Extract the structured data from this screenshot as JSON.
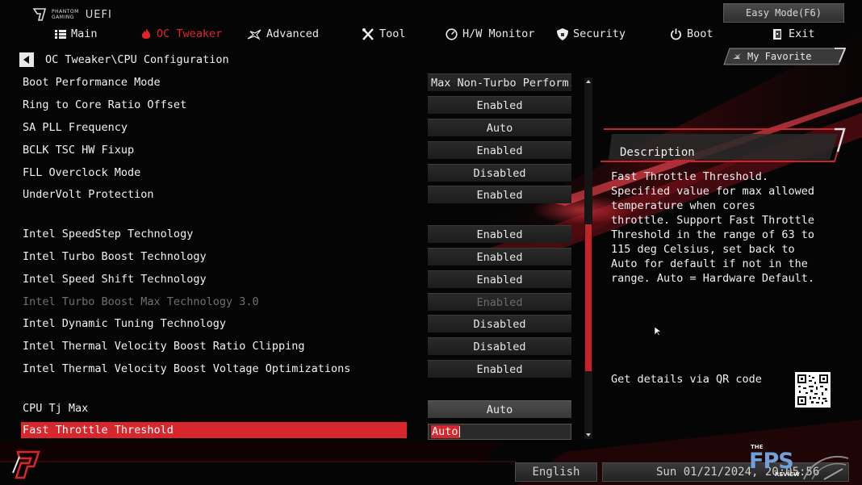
{
  "brand": {
    "line1": "PHANTOM",
    "line2": "GAMING",
    "uefi": "UEFI"
  },
  "easy_mode_label": "Easy Mode(F6)",
  "nav": [
    {
      "label": "Main",
      "icon": "list-icon",
      "active": false
    },
    {
      "label": "OC Tweaker",
      "icon": "flame-icon",
      "active": true
    },
    {
      "label": "Advanced",
      "icon": "star-icon",
      "active": false
    },
    {
      "label": "Tool",
      "icon": "tools-icon",
      "active": false
    },
    {
      "label": "H/W Monitor",
      "icon": "monitor-icon",
      "active": false
    },
    {
      "label": "Security",
      "icon": "shield-icon",
      "active": false
    },
    {
      "label": "Boot",
      "icon": "power-icon",
      "active": false
    },
    {
      "label": "Exit",
      "icon": "exit-icon",
      "active": false
    }
  ],
  "breadcrumb": "OC Tweaker\\CPU Configuration",
  "favorite_label": "My Favorite",
  "settings": [
    {
      "label": "Boot Performance Mode",
      "value": "Max Non-Turbo Perform..."
    },
    {
      "label": "Ring to Core Ratio Offset",
      "value": "Enabled"
    },
    {
      "label": "SA PLL Frequency",
      "value": "Auto"
    },
    {
      "label": "BCLK TSC HW Fixup",
      "value": "Enabled"
    },
    {
      "label": "FLL Overclock Mode",
      "value": "Disabled"
    },
    {
      "label": "UnderVolt Protection",
      "value": "Enabled"
    },
    {
      "label": "Intel SpeedStep Technology",
      "value": "Enabled"
    },
    {
      "label": "Intel Turbo Boost Technology",
      "value": "Enabled"
    },
    {
      "label": "Intel Speed Shift Technology",
      "value": "Enabled"
    },
    {
      "label": "Intel Turbo Boost Max Technology 3.0",
      "value": "Enabled"
    },
    {
      "label": "Intel Dynamic Tuning Technology",
      "value": "Disabled"
    },
    {
      "label": "Intel Thermal Velocity Boost Ratio Clipping",
      "value": "Disabled"
    },
    {
      "label": "Intel Thermal Velocity Boost Voltage Optimizations",
      "value": "Enabled"
    },
    {
      "label": "CPU Tj Max",
      "value": "Auto"
    },
    {
      "label": "Fast Throttle Threshold",
      "value": "Auto"
    }
  ],
  "description": {
    "title": "Description",
    "text": "Fast Throttle Threshold. Specified value for max allowed temperature when cores throttle. Support Fast Throttle Threshold in the range of 63 to 115 deg Celsius, set back to Auto for default if not in the range. Auto = Hardware Default."
  },
  "qr_label": "Get details via QR code",
  "language": "English",
  "datetime": "Sun 01/21/2024, 20:05:56",
  "watermark": {
    "the": "THE",
    "fps": "FPS",
    "review": "REVIEW"
  },
  "colors": {
    "accent": "#d8262d",
    "background": "#050505"
  }
}
